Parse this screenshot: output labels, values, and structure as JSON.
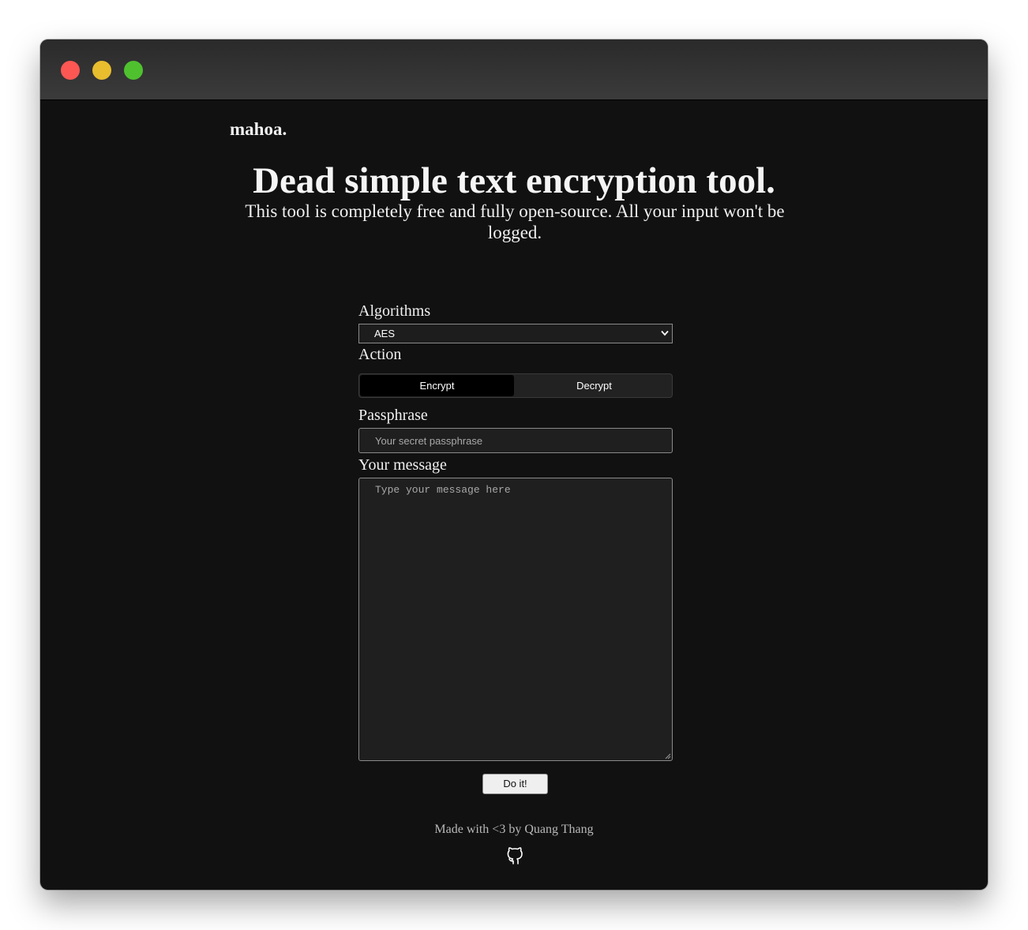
{
  "window": {
    "controls": [
      "close",
      "minimize",
      "maximize"
    ]
  },
  "header": {
    "brand": "mahoa."
  },
  "hero": {
    "title": "Dead simple text encryption tool.",
    "subtitle": "This tool is completely free and fully open-source. All your input won't be logged."
  },
  "form": {
    "algorithms_label": "Algorithms",
    "algorithm_selected": "AES",
    "action_label": "Action",
    "actions": [
      {
        "label": "Encrypt",
        "active": true
      },
      {
        "label": "Decrypt",
        "active": false
      }
    ],
    "passphrase_label": "Passphrase",
    "passphrase_placeholder": "Your secret passphrase",
    "message_label": "Your message",
    "message_placeholder": "Type your message here",
    "submit_label": "Do it!"
  },
  "footer": {
    "credit": "Made with <3 by Quang Thang",
    "icon": "github-icon"
  },
  "colors": {
    "window_bg": "#111111",
    "titlebar": "#333333",
    "close": "#fc5753",
    "minimize": "#e8bd2e",
    "maximize": "#4fc12f",
    "active_segment": "#000000"
  }
}
